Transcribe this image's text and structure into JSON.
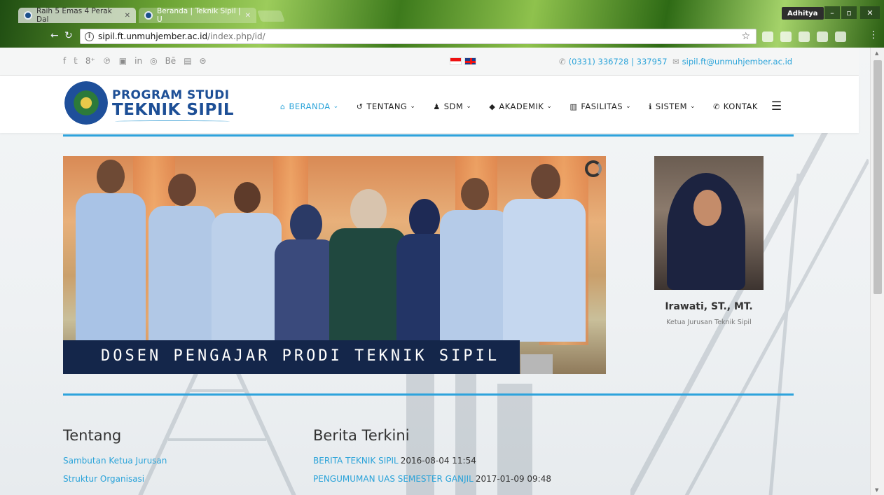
{
  "browser": {
    "tabs": [
      {
        "title": "Raih 5 Emas 4 Perak Dal"
      },
      {
        "title": "Beranda | Teknik Sipil | U"
      }
    ],
    "user": "Adhitya",
    "url_host": "sipil.ft.unmuhjember.ac.id",
    "url_path": "/index.php/id/"
  },
  "topbar": {
    "social_icons": [
      "f",
      "𝕥",
      "8⁺",
      "℗",
      "▣",
      "in",
      "◎",
      "Bē",
      "▤",
      "⊜"
    ],
    "phone": "(0331) 336728 | 337957",
    "email": "sipil.ft@unmuhjember.ac.id"
  },
  "header": {
    "logo_line1": "PROGRAM STUDI",
    "logo_line2": "TEKNIK SIPIL",
    "nav": [
      {
        "label": "BERANDA",
        "icon": "home-icon",
        "glyph": "⌂",
        "active": true,
        "dropdown": true
      },
      {
        "label": "TENTANG",
        "icon": "history-icon",
        "glyph": "↺",
        "active": false,
        "dropdown": true
      },
      {
        "label": "SDM",
        "icon": "user-icon",
        "glyph": "♟",
        "active": false,
        "dropdown": true
      },
      {
        "label": "AKADEMIK",
        "icon": "graduation-cap-icon",
        "glyph": "◆",
        "active": false,
        "dropdown": true
      },
      {
        "label": "FASILITAS",
        "icon": "building-icon",
        "glyph": "▥",
        "active": false,
        "dropdown": true
      },
      {
        "label": "SISTEM",
        "icon": "info-icon",
        "glyph": "ℹ",
        "active": false,
        "dropdown": true
      },
      {
        "label": "KONTAK",
        "icon": "phone-icon",
        "glyph": "✆",
        "active": false,
        "dropdown": false
      }
    ],
    "accent": "#2ea3dc"
  },
  "hero": {
    "caption": "DOSEN PENGAJAR PRODI TEKNIK SIPIL"
  },
  "profile": {
    "name": "Irawati, ST., MT.",
    "role": "Ketua Jurusan Teknik Sipil"
  },
  "tentang": {
    "title": "Tentang",
    "links": [
      "Sambutan Ketua Jurusan",
      "Struktur Organisasi"
    ]
  },
  "berita": {
    "title": "Berita Terkini",
    "items": [
      {
        "title": "BERITA TEKNIK SIPIL",
        "date": "2016-08-04 11:54"
      },
      {
        "title": "PENGUMUMAN UAS SEMESTER GANJIL",
        "date": "2017-01-09 09:48"
      }
    ]
  }
}
